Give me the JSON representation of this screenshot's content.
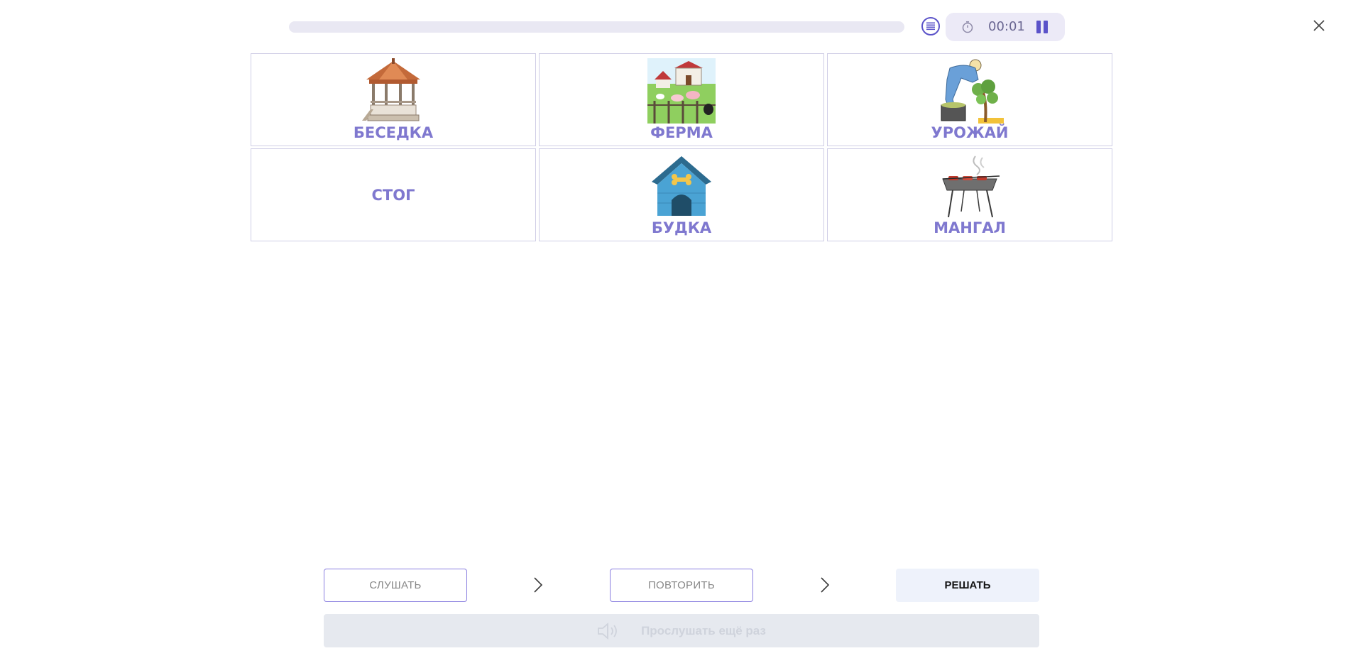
{
  "header": {
    "progress_fraction": 0.0,
    "timer": "00:01"
  },
  "cards": [
    {
      "label": "БЕСЕДКА",
      "icon": "gazebo-image"
    },
    {
      "label": "ФЕРМА",
      "icon": "farm-image"
    },
    {
      "label": "УРОЖАЙ",
      "icon": "harvest-image"
    },
    {
      "label": "СТОГ",
      "icon": ""
    },
    {
      "label": "БУДКА",
      "icon": "doghouse-image"
    },
    {
      "label": "МАНГАЛ",
      "icon": "grill-image"
    }
  ],
  "steps": {
    "listen_label": "СЛУШАТЬ",
    "repeat_label": "ПОВТОРИТЬ",
    "solve_label": "РЕШАТЬ",
    "listen_again_label": "Прослушать ещё раз"
  },
  "colors": {
    "accent": "#5b53c9",
    "card_label": "#7f78cf",
    "card_border": "#cfcde6"
  }
}
